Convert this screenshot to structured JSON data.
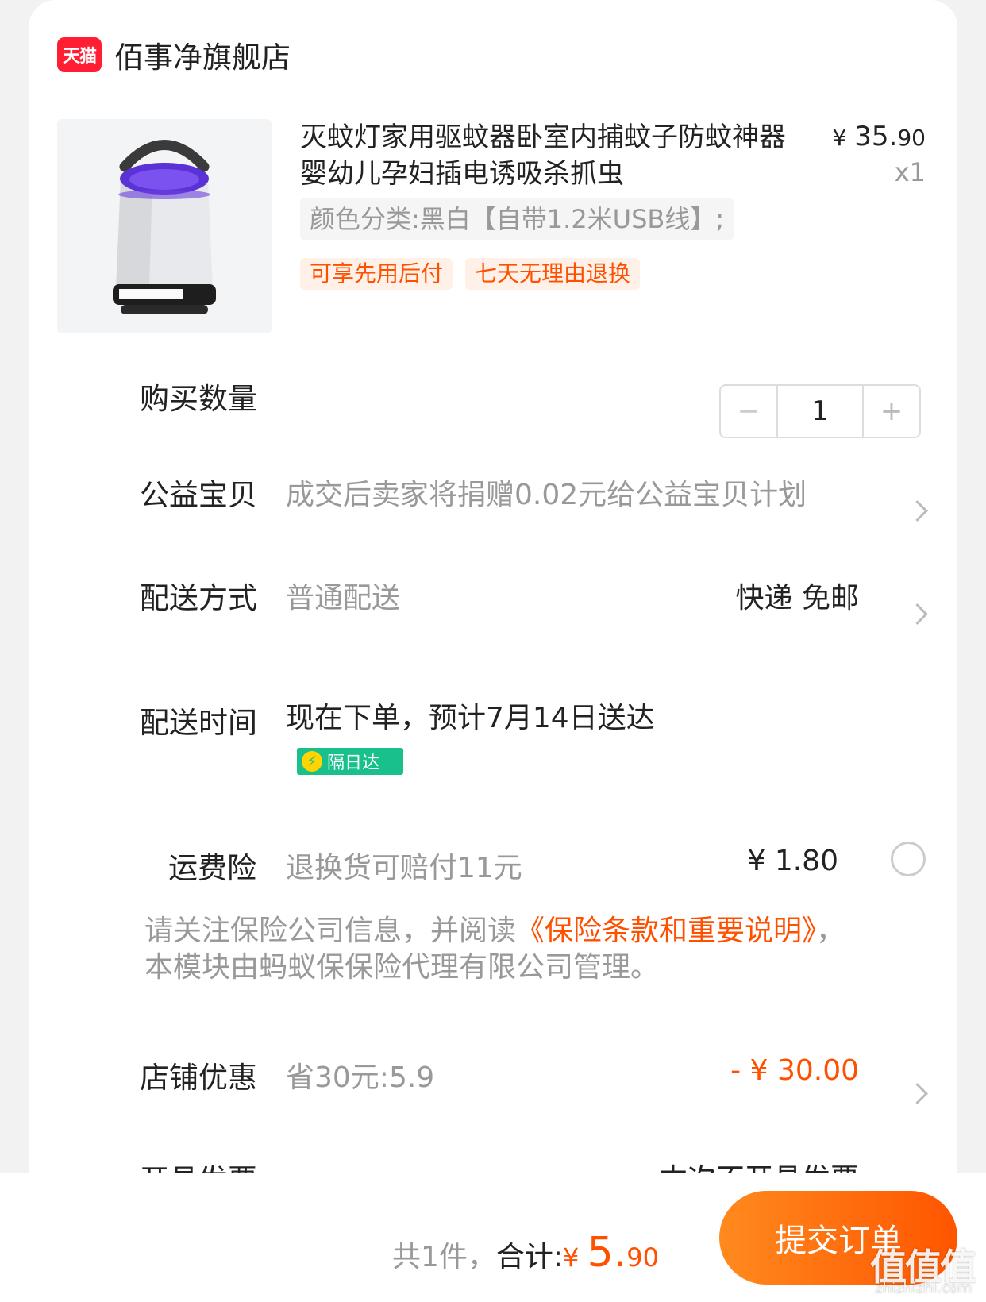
{
  "store": {
    "badge": "天猫",
    "name": "佰事净旗舰店"
  },
  "product": {
    "title": "灭蚊灯家用驱蚊器卧室内捕蚊子防蚊神器婴幼儿孕妇插电诱吸杀抓虫",
    "price_symbol": "¥",
    "price_int": "35.",
    "price_dec": "90",
    "qty_mark": "x1",
    "sku": "颜色分类:黑白【自带1.2米USB线】;",
    "tags": [
      "可享先用后付",
      "七天无理由退换"
    ],
    "image_icon": "mosquito-lamp-product-image"
  },
  "quantity": {
    "label": "购买数量",
    "value": "1",
    "minus": "−",
    "plus": "+"
  },
  "charity": {
    "label": "公益宝贝",
    "value": "成交后卖家将捐赠0.02元给公益宝贝计划"
  },
  "delivery": {
    "label": "配送方式",
    "value": "普通配送",
    "right": "快递 免邮"
  },
  "delivery_time": {
    "label": "配送时间",
    "value": "现在下单，预计7月14日送达",
    "badge": "隔日达"
  },
  "freight_insurance": {
    "label": "运费险",
    "value": "退换货可赔付11元",
    "price": "¥ 1.80"
  },
  "notice": {
    "prefix": "请关注保险公司信息，并阅读",
    "link": "《保险条款和重要说明》",
    "suffix": "，本模块由蚂蚁保保险代理有限公司管理。"
  },
  "store_discount": {
    "label": "店铺优惠",
    "value": "省30元:5.9",
    "amount": "- ¥ 30.00"
  },
  "invoice": {
    "label": "开具发票",
    "right": "本次不开具发票"
  },
  "bottom": {
    "count": "共1件，",
    "total_label": "合计:",
    "symbol": "¥ ",
    "total_int": "5.",
    "total_dec": "90",
    "submit": "提交订单"
  },
  "watermark": {
    "text": "值值值",
    "url": "zhizhizhi.com"
  },
  "colors": {
    "accent": "#ff5000",
    "tmall_red": "#ff1e32",
    "badge_green": "#19c08b"
  }
}
